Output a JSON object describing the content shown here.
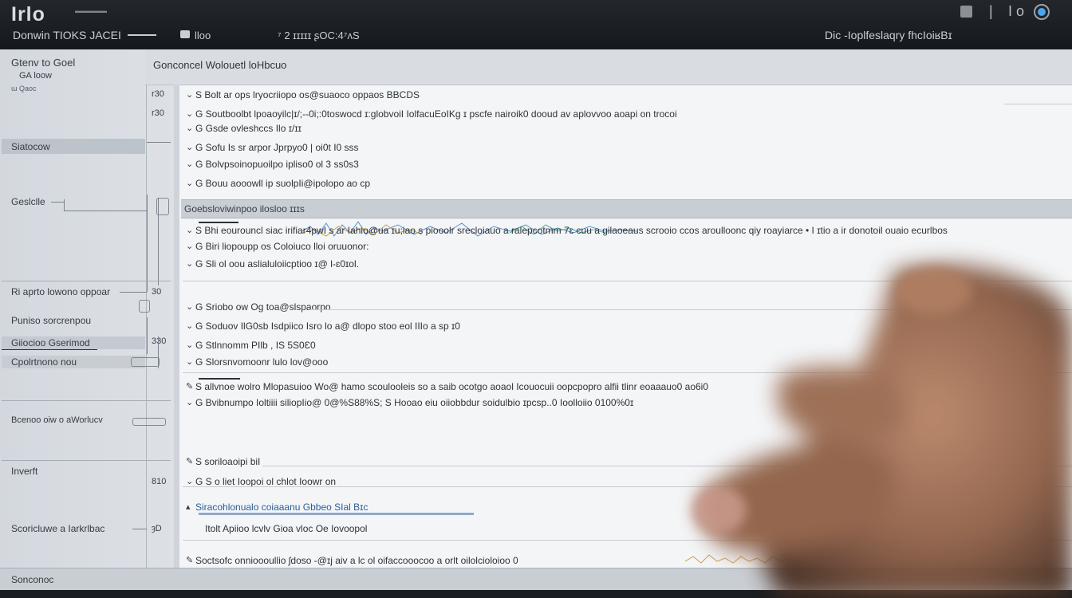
{
  "window": {
    "logo_text": "Irlo",
    "titlebar_hint": "▬▬▬▬▬",
    "app_title": "Donwin TIOKS JACEI",
    "mode_label": "lloo",
    "status_label": "⁷ 2 ɪɪɪɪɪ ʂOC:4⁷ʌS",
    "right_title": "Dic -Ioplfeslaqry fhcIoiʁBɪ",
    "controls": [
      "▌",
      "|",
      "I",
      "o"
    ]
  },
  "sidebar": {
    "header": "Gtenv to Goel",
    "subheader": "GA loow",
    "top_note": "ɯ Qaoc",
    "items": [
      {
        "label": "Siatocow",
        "num": ""
      },
      {
        "label": "Geslclle",
        "num": ""
      },
      {
        "label": "Ri aprto lowono oppoar",
        "num": "30"
      },
      {
        "label": "Puniso sorcrenpou",
        "num": ""
      },
      {
        "label": "Giiocioo Gserimod",
        "num": "330"
      },
      {
        "label": "Cpolrtnono nou",
        "num": ""
      },
      {
        "label": "Bcenoo oiw o aWorlucv",
        "num": ""
      },
      {
        "label": "Inverft",
        "num": "810"
      },
      {
        "label": "Scoricluwe a Iarkrlbac",
        "num": "ȝD"
      }
    ],
    "nums_top": [
      "r30",
      "r30"
    ]
  },
  "main": {
    "header_title": "Gonconcel Wolouetl loHbcuo",
    "lines_block1": [
      "S Bolt ar ops lryocriiopo os@suaoco oppaos BBCDS",
      "G Soutboolbt lpoaoyilc|ɪ/;--0i;:0toswocd ɪ:globvoiI IolfacuEoIKg ɪ pscfe nairoik0 dooud av aplovvoo aoapi on trocoi",
      "G Gsde ovleshccs Ilo ɪ/ɪɪ",
      "G Sofu Is sr arpor Jprpyo0 | oi0t I0 sss",
      "G Bolvpsoinopuoilpo ipliso0 ol 3 ss0s3",
      "G Bouu aooowll ip suolpIi@ipolopo ao cp"
    ],
    "section_band_label": "Goebsloviwinpoo ilosloo ɪɪɪs",
    "lines_block2": [
      "S Bhi eourouncl siac irifiar4pwI s ar Iahio@ua ɪu;iao s piooolr srecloiauo a ralepcotmm 7ɛ cuu a gilaoeaus scrooio ccos aroulloonc qiy roayiarce  • I ɪtio a ir donotoil ouaio ecurlbos",
      "G Biri liopoupp os Coloiuco lloi oruuonor:",
      "G Sli ol oou aslialuloiicptioo ɪ@ l-ɛ0ɪol."
    ],
    "lines_block3": [
      "G Sriobo ow Og toa@slspaorpo",
      "G Soduov IlG0sb Isdpiico Isro lo a@ dlopo stoo eol IIIo a sp ɪ0",
      "G Stlnnomm PIlb , IS 5S0Ɛ0",
      "G Slorsnvomoonr lulo lov@ooo"
    ],
    "lines_block4": [
      "S allvnoe wolro Mlopasuioo Wo@ hamo scoulooleis so a saib ocotgo aoaol Icouocuii oopcpopro alfii tlinr eoaaauo0 ao6i0",
      "G Bvibnumpo Ioltiiii siliopIio@ 0@%S88%S; S Hooao eiu  oiiobbdur soidulbio               ɪpcsp..0 Ioolloiio 0100%0ɪ"
    ],
    "lines_block5": [
      "S soriloaoipi biI",
      "G S o liet Ioopoi ol chlot Ioowr on"
    ],
    "highlight_line": "Siracohlonualo coiaaanu Gbbeo SIal Bɪc",
    "highlight_sub": "Itolt Apiioo lcvlv Gioa vloc Oe Iovoopol",
    "last_line": "Soctsofc onnioooullio ʃdoso  -@ɪj aiv a lc ol oifaccooocoo a orlt oilolcioloioo 0"
  },
  "statusbar": {
    "text": "Sonconoc"
  },
  "colors": {
    "titlebar": "#1b1f24",
    "sidebar": "#d6dbe0",
    "main_bg": "#f3f5f7",
    "accent_blue": "#4ea4ea",
    "wave_blue": "#5a8fd0",
    "wave_gold": "#c9a24a",
    "wave_teal": "#4fb3a4"
  }
}
